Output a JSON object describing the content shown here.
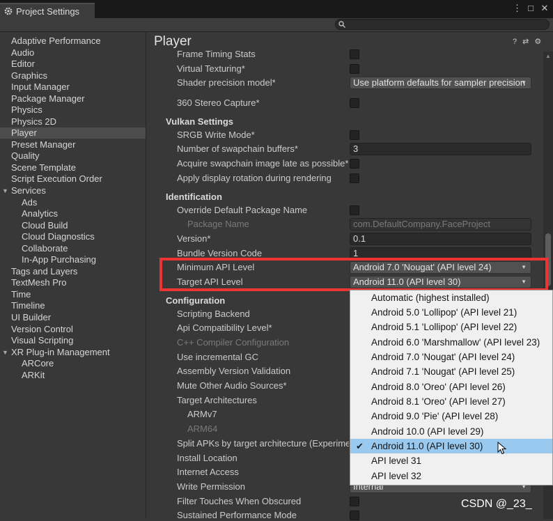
{
  "window": {
    "tab_title": "Project Settings",
    "controls": [
      "⋮",
      "□",
      "✕"
    ]
  },
  "search": {
    "placeholder": ""
  },
  "sidebar": {
    "items": [
      {
        "label": "Adaptive Performance"
      },
      {
        "label": "Audio"
      },
      {
        "label": "Editor"
      },
      {
        "label": "Graphics"
      },
      {
        "label": "Input Manager"
      },
      {
        "label": "Package Manager"
      },
      {
        "label": "Physics"
      },
      {
        "label": "Physics 2D"
      },
      {
        "label": "Player"
      },
      {
        "label": "Preset Manager"
      },
      {
        "label": "Quality"
      },
      {
        "label": "Scene Template"
      },
      {
        "label": "Script Execution Order"
      },
      {
        "label": "Services"
      },
      {
        "label": "Ads"
      },
      {
        "label": "Analytics"
      },
      {
        "label": "Cloud Build"
      },
      {
        "label": "Cloud Diagnostics"
      },
      {
        "label": "Collaborate"
      },
      {
        "label": "In-App Purchasing"
      },
      {
        "label": "Tags and Layers"
      },
      {
        "label": "TextMesh Pro"
      },
      {
        "label": "Time"
      },
      {
        "label": "Timeline"
      },
      {
        "label": "UI Builder"
      },
      {
        "label": "Version Control"
      },
      {
        "label": "Visual Scripting"
      },
      {
        "label": "XR Plug-in Management"
      },
      {
        "label": "ARCore"
      },
      {
        "label": "ARKit"
      }
    ],
    "selected": "Player",
    "fold_glyph": "▼"
  },
  "main": {
    "title": "Player",
    "header_icons": [
      "?",
      "⇄",
      "⚙"
    ],
    "rows": {
      "frame_timing": "Frame Timing Stats",
      "virtual_texturing": "Virtual Texturing*",
      "shader_precision": "Shader precision model*",
      "shader_precision_value": "Use platform defaults for sampler precision",
      "stereo_capture": "360 Stereo Capture*",
      "vulkan_section": "Vulkan Settings",
      "srgb_write": "SRGB Write Mode*",
      "swapchain_buffers": "Number of swapchain buffers*",
      "swapchain_buffers_value": "3",
      "acquire_swapchain": "Acquire swapchain image late as possible*",
      "display_rotation": "Apply display rotation during rendering",
      "identification_section": "Identification",
      "override_package": "Override Default Package Name",
      "package_name": "Package Name",
      "package_name_value": "com.DefaultCompany.FaceProject",
      "version": "Version*",
      "version_value": "0.1",
      "bundle_code": "Bundle Version Code",
      "bundle_code_value": "1",
      "min_api": "Minimum API Level",
      "min_api_value": "Android 7.0 'Nougat' (API level 24)",
      "target_api": "Target API Level",
      "target_api_value": "Android 11.0 (API level 30)",
      "configuration_section": "Configuration",
      "scripting_backend": "Scripting Backend",
      "api_compat": "Api Compatibility Level*",
      "cpp_compiler": "C++ Compiler Configuration",
      "incremental_gc": "Use incremental GC",
      "assembly_validation": "Assembly Version Validation",
      "mute_audio": "Mute Other Audio Sources*",
      "target_arch": "Target Architectures",
      "armv7": "ARMv7",
      "arm64": "ARM64",
      "split_apks": "Split APKs by target architecture (Experimental)",
      "install_location": "Install Location",
      "internet_access": "Internet Access",
      "write_permission": "Write Permission",
      "write_permission_value": "Internal",
      "filter_touches": "Filter Touches When Obscured",
      "sustained_perf": "Sustained Performance Mode"
    }
  },
  "dropdown_arrow": "▼",
  "api_popup": {
    "items": [
      {
        "label": "Automatic (highest installed)"
      },
      {
        "label": "Android 5.0 'Lollipop' (API level 21)"
      },
      {
        "label": "Android 5.1 'Lollipop' (API level 22)"
      },
      {
        "label": "Android 6.0 'Marshmallow' (API level 23)"
      },
      {
        "label": "Android 7.0 'Nougat' (API level 24)"
      },
      {
        "label": "Android 7.1 'Nougat' (API level 25)"
      },
      {
        "label": "Android 8.0 'Oreo' (API level 26)"
      },
      {
        "label": "Android 8.1 'Oreo' (API level 27)"
      },
      {
        "label": "Android 9.0 'Pie' (API level 28)"
      },
      {
        "label": "Android 10.0 (API level 29)"
      },
      {
        "label": "Android 11.0 (API level 30)"
      },
      {
        "label": "API level 31"
      },
      {
        "label": "API level 32"
      }
    ],
    "selected": "Android 11.0 (API level 30)",
    "check_glyph": "✔"
  },
  "watermark": "CSDN @_23_",
  "colors": {
    "highlight_box": "#ee3333",
    "popup_selected": "#99c9ef",
    "sidebar_selected": "#4d4d4d"
  }
}
